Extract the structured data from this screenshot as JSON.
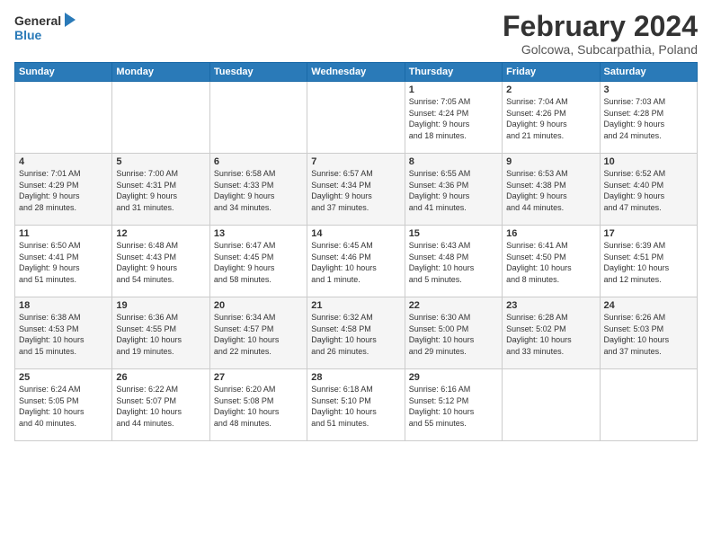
{
  "logo": {
    "general": "General",
    "blue": "Blue"
  },
  "title": "February 2024",
  "subtitle": "Golcowa, Subcarpathia, Poland",
  "headers": [
    "Sunday",
    "Monday",
    "Tuesday",
    "Wednesday",
    "Thursday",
    "Friday",
    "Saturday"
  ],
  "weeks": [
    [
      {
        "day": "",
        "info": ""
      },
      {
        "day": "",
        "info": ""
      },
      {
        "day": "",
        "info": ""
      },
      {
        "day": "",
        "info": ""
      },
      {
        "day": "1",
        "info": "Sunrise: 7:05 AM\nSunset: 4:24 PM\nDaylight: 9 hours\nand 18 minutes."
      },
      {
        "day": "2",
        "info": "Sunrise: 7:04 AM\nSunset: 4:26 PM\nDaylight: 9 hours\nand 21 minutes."
      },
      {
        "day": "3",
        "info": "Sunrise: 7:03 AM\nSunset: 4:28 PM\nDaylight: 9 hours\nand 24 minutes."
      }
    ],
    [
      {
        "day": "4",
        "info": "Sunrise: 7:01 AM\nSunset: 4:29 PM\nDaylight: 9 hours\nand 28 minutes."
      },
      {
        "day": "5",
        "info": "Sunrise: 7:00 AM\nSunset: 4:31 PM\nDaylight: 9 hours\nand 31 minutes."
      },
      {
        "day": "6",
        "info": "Sunrise: 6:58 AM\nSunset: 4:33 PM\nDaylight: 9 hours\nand 34 minutes."
      },
      {
        "day": "7",
        "info": "Sunrise: 6:57 AM\nSunset: 4:34 PM\nDaylight: 9 hours\nand 37 minutes."
      },
      {
        "day": "8",
        "info": "Sunrise: 6:55 AM\nSunset: 4:36 PM\nDaylight: 9 hours\nand 41 minutes."
      },
      {
        "day": "9",
        "info": "Sunrise: 6:53 AM\nSunset: 4:38 PM\nDaylight: 9 hours\nand 44 minutes."
      },
      {
        "day": "10",
        "info": "Sunrise: 6:52 AM\nSunset: 4:40 PM\nDaylight: 9 hours\nand 47 minutes."
      }
    ],
    [
      {
        "day": "11",
        "info": "Sunrise: 6:50 AM\nSunset: 4:41 PM\nDaylight: 9 hours\nand 51 minutes."
      },
      {
        "day": "12",
        "info": "Sunrise: 6:48 AM\nSunset: 4:43 PM\nDaylight: 9 hours\nand 54 minutes."
      },
      {
        "day": "13",
        "info": "Sunrise: 6:47 AM\nSunset: 4:45 PM\nDaylight: 9 hours\nand 58 minutes."
      },
      {
        "day": "14",
        "info": "Sunrise: 6:45 AM\nSunset: 4:46 PM\nDaylight: 10 hours\nand 1 minute."
      },
      {
        "day": "15",
        "info": "Sunrise: 6:43 AM\nSunset: 4:48 PM\nDaylight: 10 hours\nand 5 minutes."
      },
      {
        "day": "16",
        "info": "Sunrise: 6:41 AM\nSunset: 4:50 PM\nDaylight: 10 hours\nand 8 minutes."
      },
      {
        "day": "17",
        "info": "Sunrise: 6:39 AM\nSunset: 4:51 PM\nDaylight: 10 hours\nand 12 minutes."
      }
    ],
    [
      {
        "day": "18",
        "info": "Sunrise: 6:38 AM\nSunset: 4:53 PM\nDaylight: 10 hours\nand 15 minutes."
      },
      {
        "day": "19",
        "info": "Sunrise: 6:36 AM\nSunset: 4:55 PM\nDaylight: 10 hours\nand 19 minutes."
      },
      {
        "day": "20",
        "info": "Sunrise: 6:34 AM\nSunset: 4:57 PM\nDaylight: 10 hours\nand 22 minutes."
      },
      {
        "day": "21",
        "info": "Sunrise: 6:32 AM\nSunset: 4:58 PM\nDaylight: 10 hours\nand 26 minutes."
      },
      {
        "day": "22",
        "info": "Sunrise: 6:30 AM\nSunset: 5:00 PM\nDaylight: 10 hours\nand 29 minutes."
      },
      {
        "day": "23",
        "info": "Sunrise: 6:28 AM\nSunset: 5:02 PM\nDaylight: 10 hours\nand 33 minutes."
      },
      {
        "day": "24",
        "info": "Sunrise: 6:26 AM\nSunset: 5:03 PM\nDaylight: 10 hours\nand 37 minutes."
      }
    ],
    [
      {
        "day": "25",
        "info": "Sunrise: 6:24 AM\nSunset: 5:05 PM\nDaylight: 10 hours\nand 40 minutes."
      },
      {
        "day": "26",
        "info": "Sunrise: 6:22 AM\nSunset: 5:07 PM\nDaylight: 10 hours\nand 44 minutes."
      },
      {
        "day": "27",
        "info": "Sunrise: 6:20 AM\nSunset: 5:08 PM\nDaylight: 10 hours\nand 48 minutes."
      },
      {
        "day": "28",
        "info": "Sunrise: 6:18 AM\nSunset: 5:10 PM\nDaylight: 10 hours\nand 51 minutes."
      },
      {
        "day": "29",
        "info": "Sunrise: 6:16 AM\nSunset: 5:12 PM\nDaylight: 10 hours\nand 55 minutes."
      },
      {
        "day": "",
        "info": ""
      },
      {
        "day": "",
        "info": ""
      }
    ]
  ]
}
